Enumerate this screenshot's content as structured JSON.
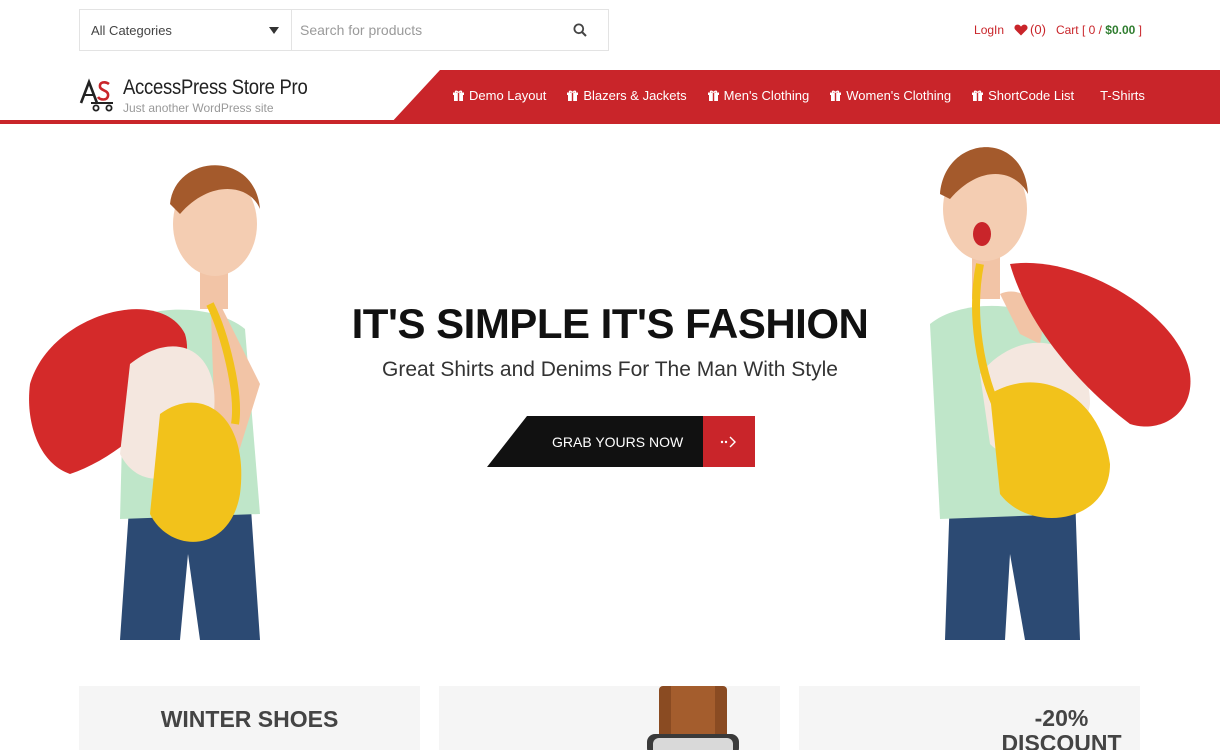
{
  "search": {
    "category_selected": "All Categories",
    "placeholder": "Search for products"
  },
  "top_links": {
    "login": "LogIn",
    "wishlist_count": "(0)",
    "cart_label": "Cart [ 0 / ",
    "cart_total": "$0.00",
    "cart_close": " ]"
  },
  "site": {
    "title": "AccessPress Store Pro",
    "tagline": "Just another WordPress site"
  },
  "nav": {
    "items": [
      {
        "label": "Demo Layout"
      },
      {
        "label": "Blazers & Jackets"
      },
      {
        "label": "Men's Clothing"
      },
      {
        "label": "Women's Clothing"
      },
      {
        "label": "ShortCode List"
      },
      {
        "label": "T-Shirts"
      }
    ]
  },
  "hero": {
    "title": "IT'S SIMPLE IT'S FASHION",
    "subtitle": "Great Shirts and Denims For The Man With Style",
    "cta": "GRAB YOURS NOW"
  },
  "promos": {
    "card1_title": "WINTER SHOES",
    "card3_line1": "-20%",
    "card3_line2": "DISCOUNT"
  },
  "colors": {
    "accent": "#c9252a",
    "cta_dark": "#111111",
    "cart_total": "#2f7d2f"
  }
}
